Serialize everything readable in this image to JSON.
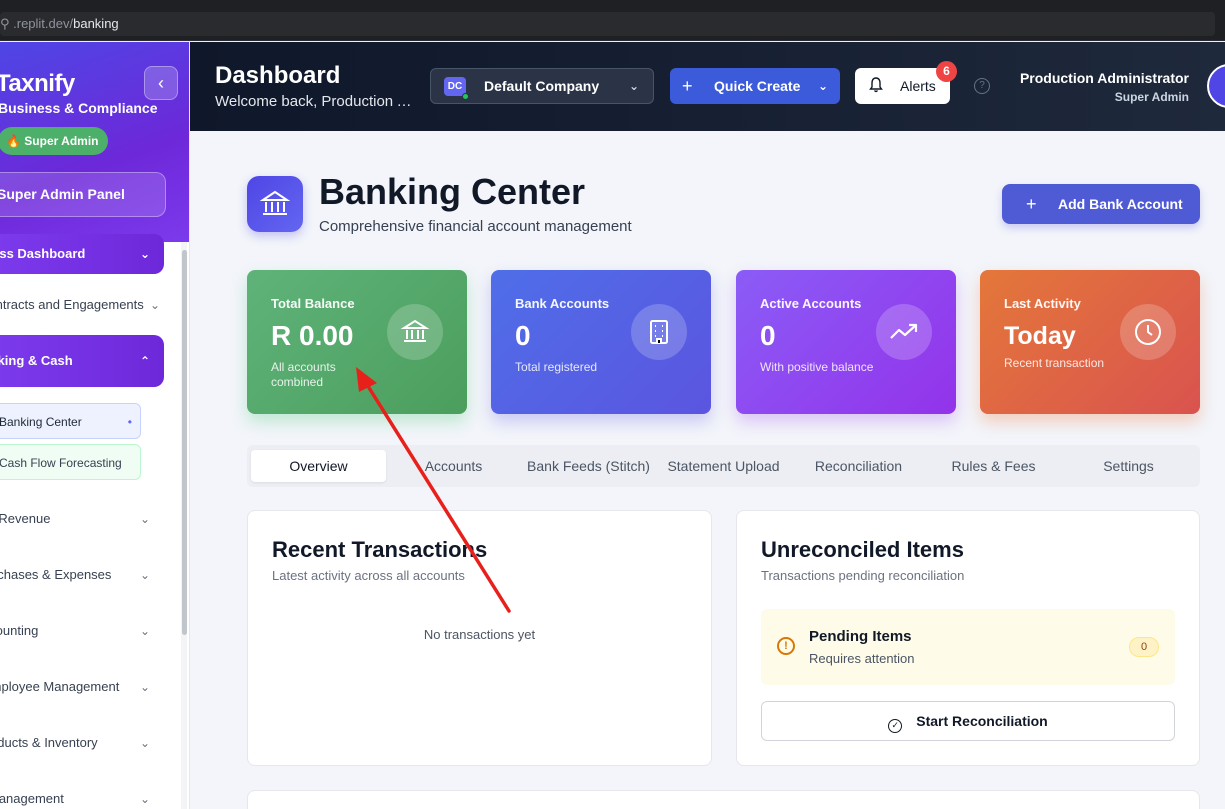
{
  "browser": {
    "url_host": "⚲ .replit.dev/",
    "url_path": "banking"
  },
  "sidebar": {
    "logo": "Taxnify",
    "subtitle": "Business & Compliance",
    "role_badge": "🔥 Super Admin",
    "admin_panel": "Super Admin Panel",
    "items": [
      {
        "label": "Business Dashboard"
      },
      {
        "label": "Contracts and Engagements"
      },
      {
        "label": "Banking & Cash"
      },
      {
        "label": "Sales & Revenue"
      },
      {
        "label": "Purchases & Expenses"
      },
      {
        "label": "Accounting"
      },
      {
        "label": "Employee Management"
      },
      {
        "label": "Products & Inventory"
      },
      {
        "label": "Management"
      }
    ],
    "sub_items": [
      {
        "label": "Banking Center",
        "dot": "•"
      },
      {
        "label": "Cash Flow Forecasting"
      }
    ]
  },
  "header": {
    "title": "Dashboard",
    "welcome": "Welcome back, Production Administrator",
    "company_initials": "DC",
    "company": "Default Company",
    "quick_create": "Quick Create",
    "alerts": "Alerts",
    "alerts_count": "6",
    "user_name": "Production Administrator",
    "user_role": "Super Admin"
  },
  "page": {
    "title": "Banking Center",
    "subtitle": "Comprehensive financial account management",
    "add_button": "Add Bank Account"
  },
  "stats": [
    {
      "label": "Total Balance",
      "value": "R 0.00",
      "note": "All accounts combined",
      "icon": "bank-icon",
      "color": "#5fb37a"
    },
    {
      "label": "Bank Accounts",
      "value": "0",
      "note": "Total registered",
      "icon": "building-icon",
      "color": "#4f6ee8"
    },
    {
      "label": "Active Accounts",
      "value": "0",
      "note": "With positive balance",
      "icon": "trending-up-icon",
      "color": "#8b5cf6"
    },
    {
      "label": "Last Activity",
      "value": "Today",
      "note": "Recent transaction",
      "icon": "clock-icon",
      "color": "#e4773a"
    }
  ],
  "tabs": [
    "Overview",
    "Accounts",
    "Bank Feeds (Stitch)",
    "Statement Upload",
    "Reconciliation",
    "Rules & Fees",
    "Settings"
  ],
  "recent": {
    "title": "Recent Transactions",
    "subtitle": "Latest activity across all accounts",
    "empty": "No transactions yet"
  },
  "unreconciled": {
    "title": "Unreconciled Items",
    "subtitle": "Transactions pending reconciliation",
    "pending_title": "Pending Items",
    "pending_sub": "Requires attention",
    "pending_count": "0",
    "start_button": "Start Reconciliation"
  }
}
